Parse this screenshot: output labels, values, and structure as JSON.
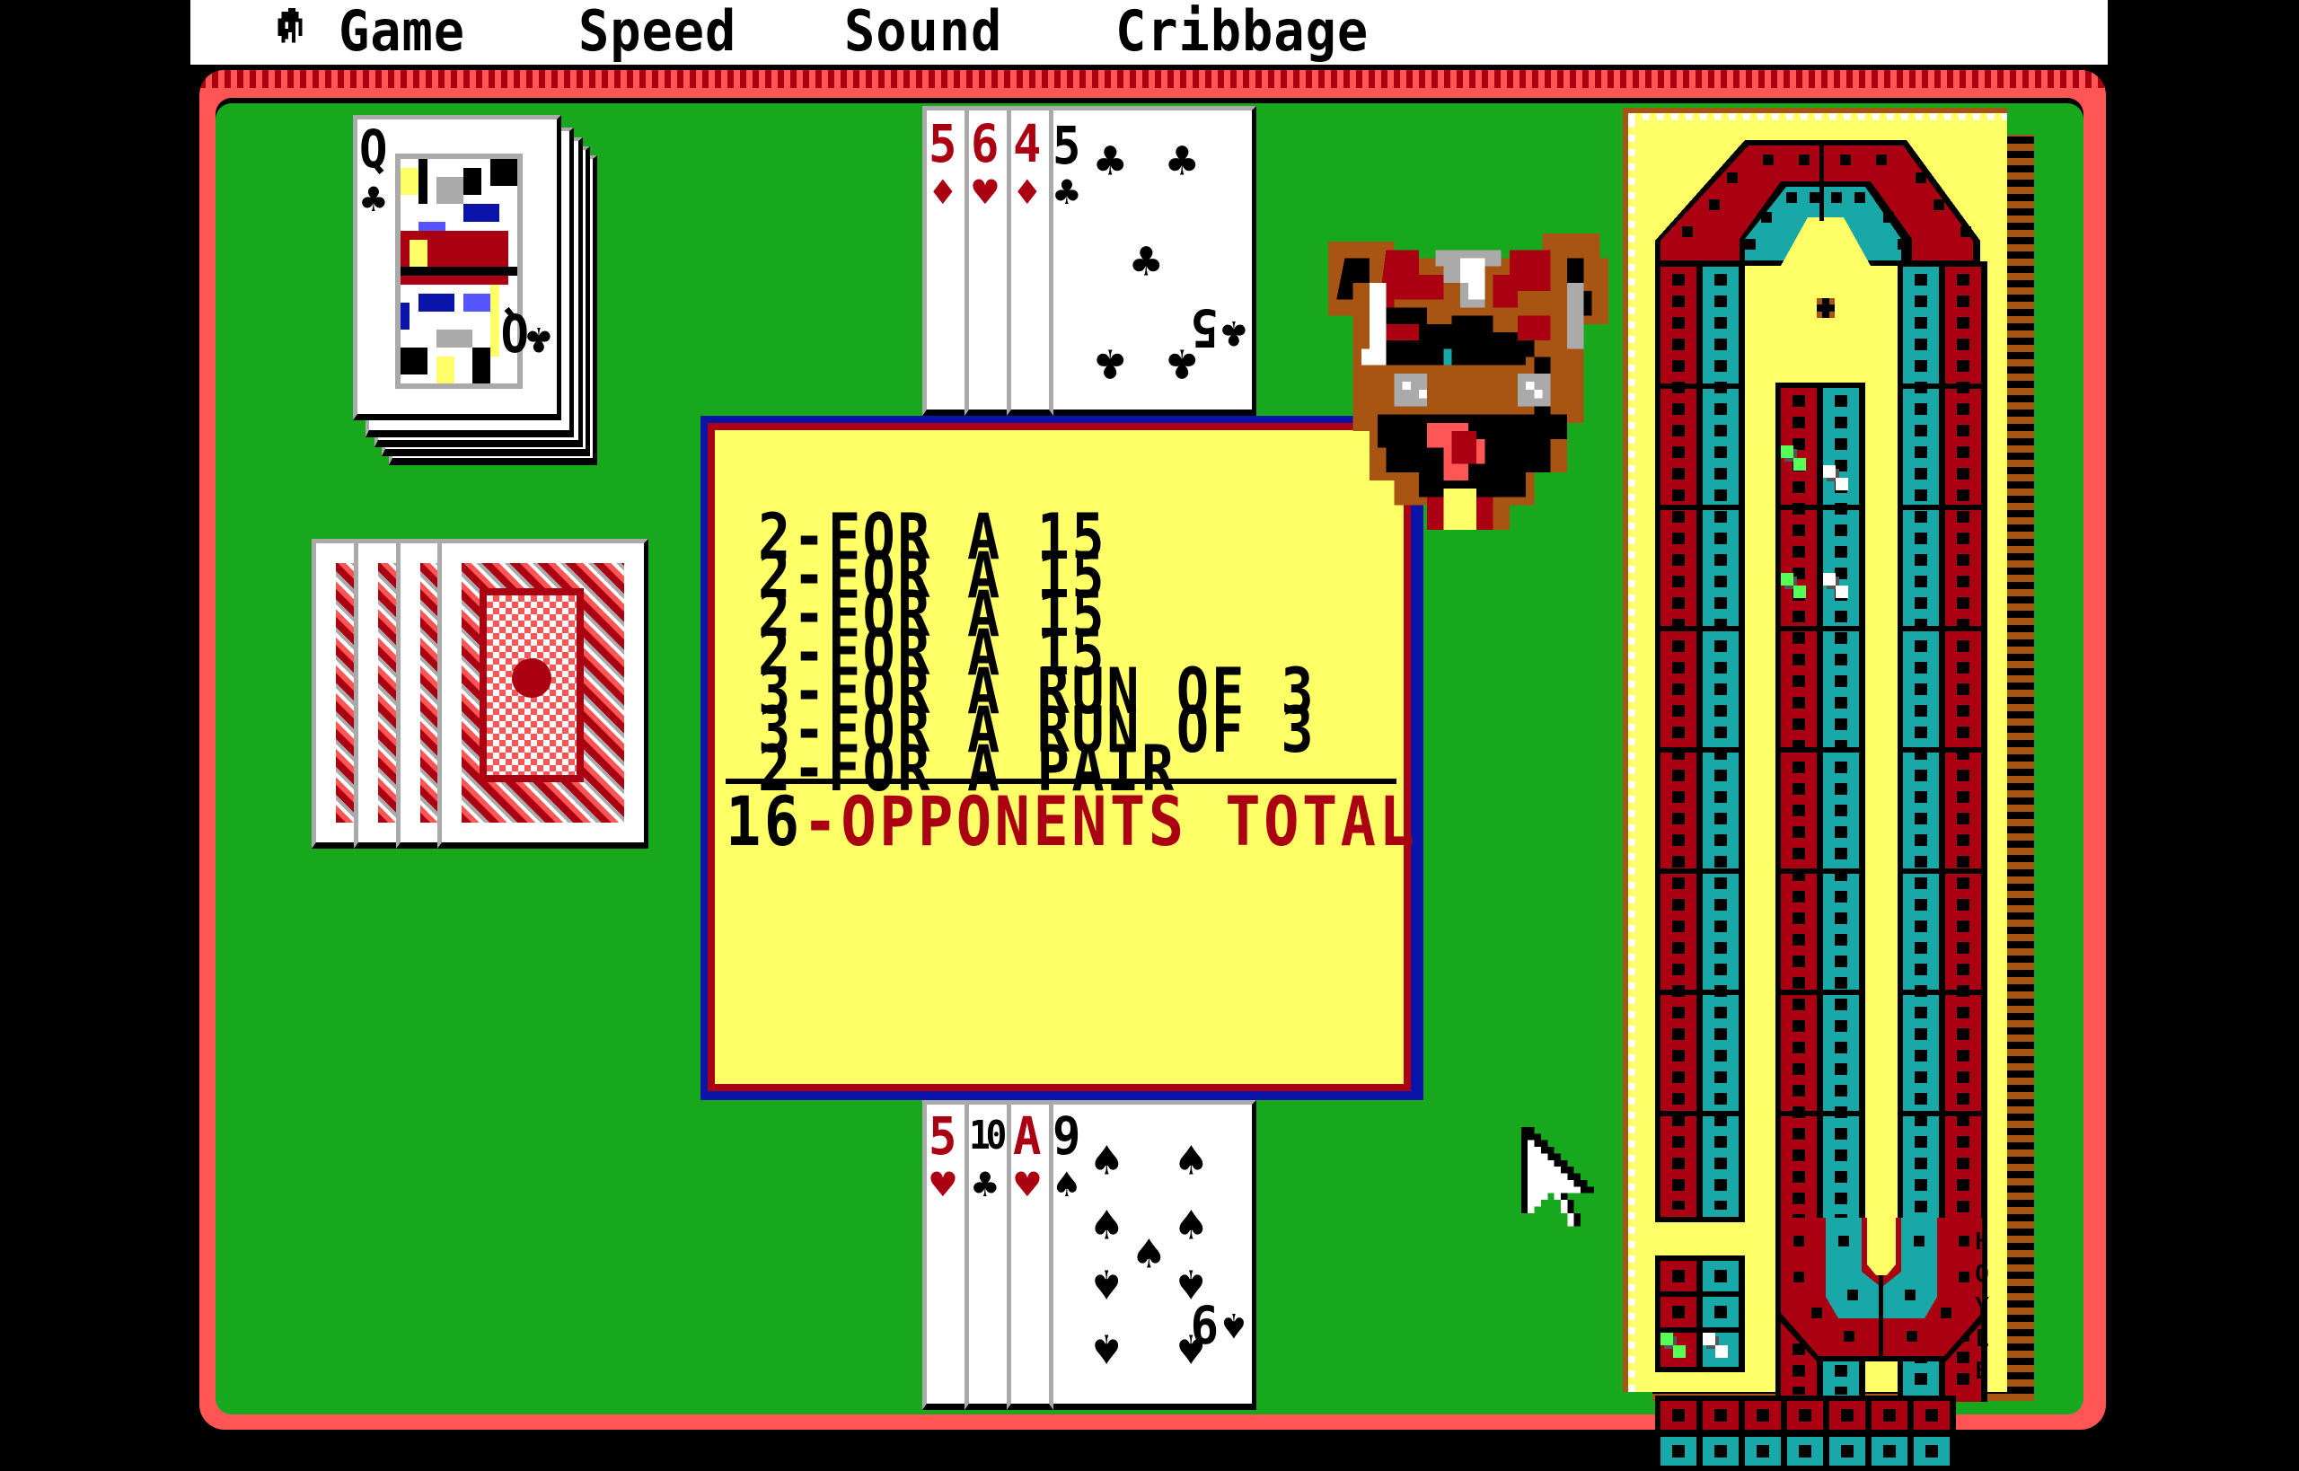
{
  "menu": {
    "apple_icon": "apple-icon",
    "items": [
      "Game",
      "Speed",
      "Sound",
      "Cribbage"
    ]
  },
  "deck": {
    "top_card": {
      "rank": "Q",
      "suit": "♣",
      "color": "black"
    },
    "label": "deck"
  },
  "crib": {
    "face_down_count": 4
  },
  "opponent_hand": [
    {
      "rank": "5",
      "suit": "♦",
      "color": "red"
    },
    {
      "rank": "6",
      "suit": "♥",
      "color": "red"
    },
    {
      "rank": "4",
      "suit": "♦",
      "color": "red"
    },
    {
      "rank": "5",
      "suit": "♣",
      "color": "black"
    }
  ],
  "player_hand": [
    {
      "rank": "5",
      "suit": "♥",
      "color": "red"
    },
    {
      "rank": "10",
      "suit": "♣",
      "color": "black"
    },
    {
      "rank": "A",
      "suit": "♥",
      "color": "red"
    },
    {
      "rank": "9",
      "suit": "♠",
      "color": "black"
    }
  ],
  "scoring": {
    "lines": [
      "2-FOR A 15",
      "2-FOR A 15",
      "2-FOR A 15",
      "2-FOR A 15",
      "3-FOR A RUN OF 3",
      "3-FOR A RUN OF 3",
      "2-FOR A PAIR"
    ],
    "total_points": "16",
    "total_sep": "-",
    "total_label": "OPPONENTS TOTAL"
  },
  "opponent": {
    "portrait": "bulldog"
  },
  "board": {
    "brand": "HOYLE",
    "colors": {
      "red_track": "#aa0011",
      "teal_track": "#18a8a8",
      "board": "#ffff66"
    },
    "pegs": {
      "green": "player-1",
      "white": "player-2"
    }
  },
  "colors": {
    "felt": "#18a81e",
    "table_border": "#ff5555",
    "dialog_bg": "#ffff66",
    "dialog_border": "#0a14a8",
    "total_label": "#aa0011"
  }
}
